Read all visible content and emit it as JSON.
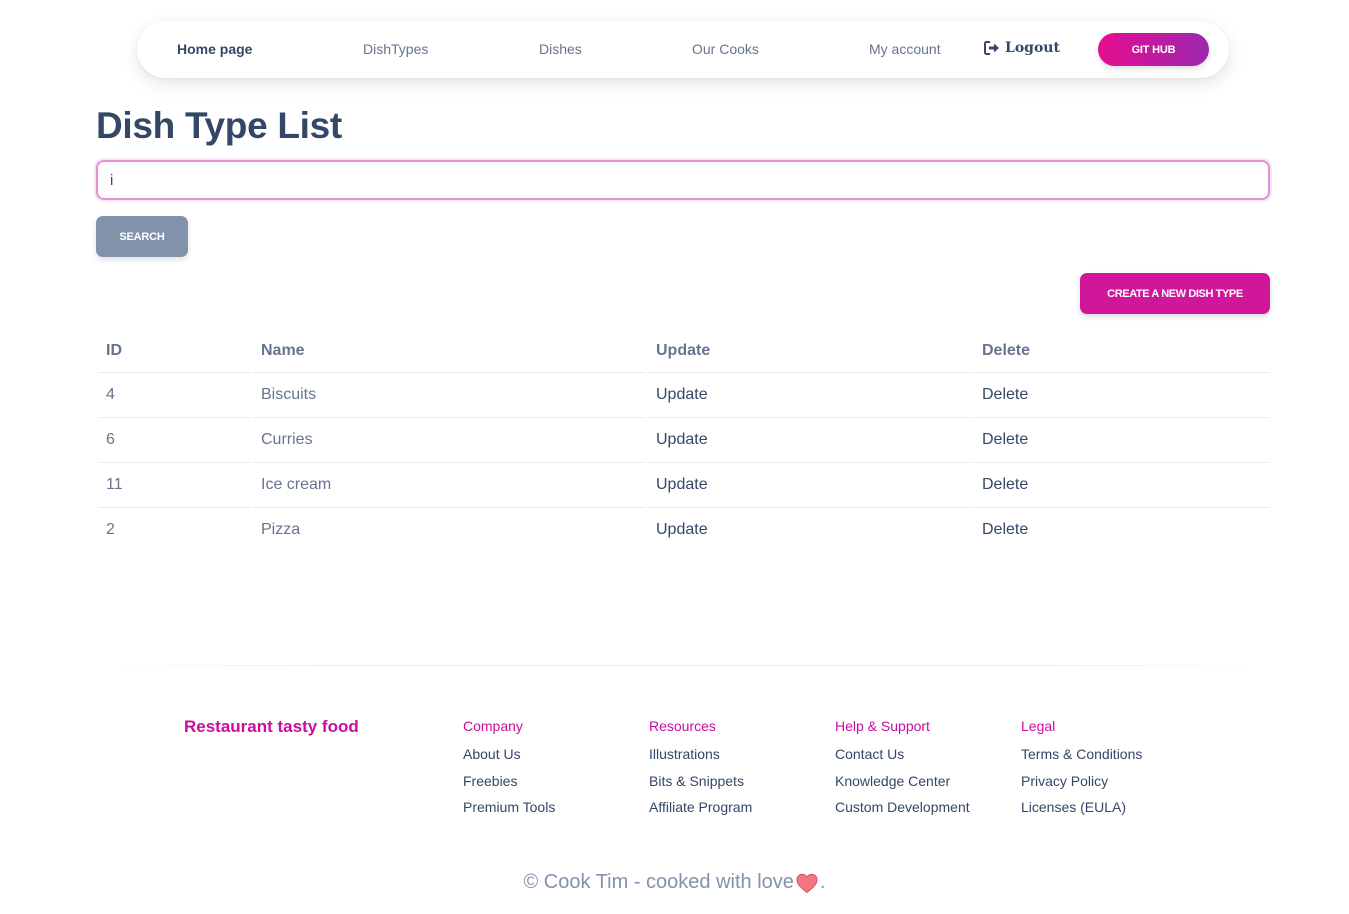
{
  "nav": {
    "items": [
      {
        "label": "Home page"
      },
      {
        "label": "DishTypes"
      },
      {
        "label": "Dishes"
      },
      {
        "label": "Our Cooks"
      },
      {
        "label": "My account"
      }
    ],
    "logout_label": "Logout",
    "github_label": "GIT HUB",
    "accent_gradient": [
      "#e60d8f",
      "#9c27b0"
    ]
  },
  "page": {
    "title": "Dish Type List"
  },
  "search": {
    "value": "i",
    "placeholder": "",
    "button_label": "SEARCH"
  },
  "create_button_label": "CREATE A NEW DISH TYPE",
  "table": {
    "headers": [
      "ID",
      "Name",
      "Update",
      "Delete"
    ],
    "rows": [
      {
        "id": "4",
        "name": "Biscuits",
        "update": "Update",
        "delete": "Delete"
      },
      {
        "id": "6",
        "name": "Curries",
        "update": "Update",
        "delete": "Delete"
      },
      {
        "id": "11",
        "name": "Ice cream",
        "update": "Update",
        "delete": "Delete"
      },
      {
        "id": "2",
        "name": "Pizza",
        "update": "Update",
        "delete": "Delete"
      }
    ]
  },
  "footer": {
    "brand": "Restaurant tasty food",
    "columns": [
      {
        "title": "Company",
        "links": [
          "About Us",
          "Freebies",
          "Premium Tools"
        ]
      },
      {
        "title": "Resources",
        "links": [
          "Illustrations",
          "Bits & Snippets",
          "Affiliate Program"
        ]
      },
      {
        "title": "Help & Support",
        "links": [
          "Contact Us",
          "Knowledge Center",
          "Custom Development"
        ]
      },
      {
        "title": "Legal",
        "links": [
          "Terms & Conditions",
          "Privacy Policy",
          "Licenses (EULA)"
        ]
      }
    ],
    "copyright_prefix": "© Cook Tim - cooked with love",
    "copyright_suffix": ".",
    "accent_color": "#cb0c9f"
  },
  "icons": {
    "logout": "sign-out-icon",
    "heart": "heart-icon"
  }
}
